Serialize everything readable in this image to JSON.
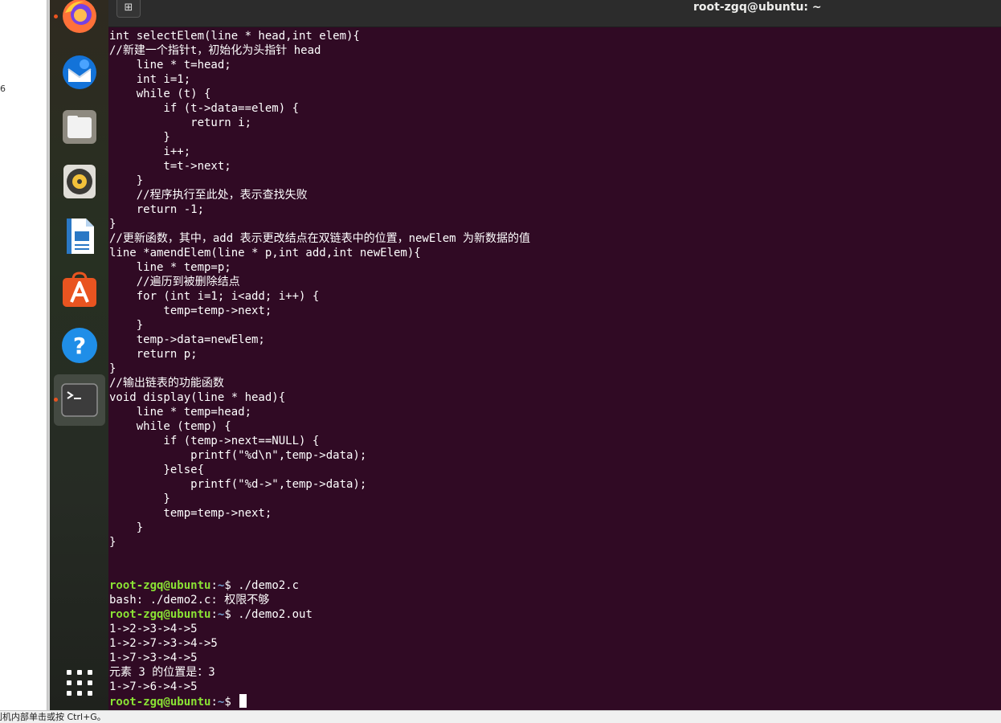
{
  "window": {
    "title": "root-zgq@ubuntu: ~"
  },
  "host": {
    "left_mark": "6",
    "status_text": "到机内部单击或按 Ctrl+G。"
  },
  "dock": {
    "items": [
      {
        "name": "Firefox",
        "icon": "firefox-icon"
      },
      {
        "name": "Thunderbird",
        "icon": "thunderbird-icon"
      },
      {
        "name": "Files",
        "icon": "files-icon"
      },
      {
        "name": "Rhythmbox",
        "icon": "rhythmbox-icon"
      },
      {
        "name": "LibreOffice Writer",
        "icon": "writer-icon"
      },
      {
        "name": "Ubuntu Software",
        "icon": "software-icon"
      },
      {
        "name": "Help",
        "icon": "help-icon"
      },
      {
        "name": "Terminal",
        "icon": "terminal-icon"
      },
      {
        "name": "Show Applications",
        "icon": "app-grid-icon"
      }
    ]
  },
  "terminal": {
    "code_lines": [
      "int selectElem(line * head,int elem){",
      "//新建一个指针t，初始化为头指针 head",
      "    line * t=head;",
      "    int i=1;",
      "    while (t) {",
      "        if (t->data==elem) {",
      "            return i;",
      "        }",
      "        i++;",
      "        t=t->next;",
      "    }",
      "    //程序执行至此处，表示查找失败",
      "    return -1;",
      "}",
      "//更新函数，其中，add 表示更改结点在双链表中的位置，newElem 为新数据的值",
      "line *amendElem(line * p,int add,int newElem){",
      "    line * temp=p;",
      "    //遍历到被删除结点",
      "    for (int i=1; i<add; i++) {",
      "        temp=temp->next;",
      "    }",
      "    temp->data=newElem;",
      "    return p;",
      "}",
      "//输出链表的功能函数",
      "void display(line * head){",
      "    line * temp=head;",
      "    while (temp) {",
      "        if (temp->next==NULL) {",
      "            printf(\"%d\\n\",temp->data);",
      "        }else{",
      "            printf(\"%d->\",temp->data);",
      "        }",
      "        temp=temp->next;",
      "    }",
      "}",
      "",
      ""
    ],
    "prompt_user": "root-zgq@ubuntu",
    "prompt_path": "~",
    "prompt_sep": ":",
    "prompt_dollar": "$ ",
    "commands": [
      {
        "cmd": "./demo2.c",
        "output": [
          "bash: ./demo2.c: 权限不够"
        ]
      },
      {
        "cmd": "./demo2.out",
        "output": [
          "1->2->3->4->5",
          "1->2->7->3->4->5",
          "1->7->3->4->5",
          "元素 3 的位置是：3",
          "1->7->6->4->5"
        ]
      }
    ]
  }
}
